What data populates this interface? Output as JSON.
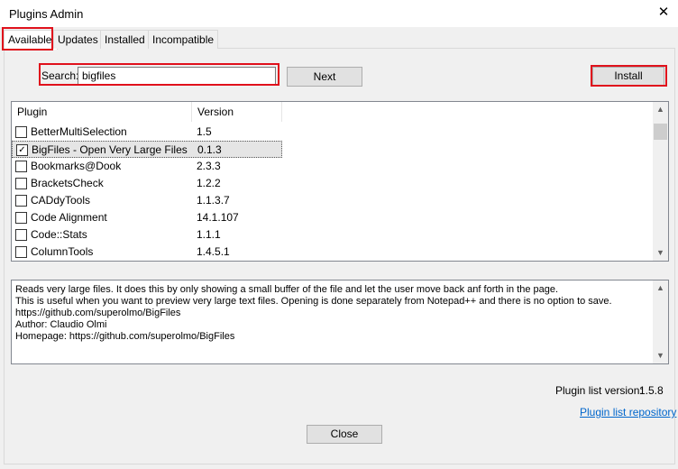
{
  "window": {
    "title": "Plugins Admin"
  },
  "tabs": [
    {
      "label": "Available"
    },
    {
      "label": "Updates"
    },
    {
      "label": "Installed"
    },
    {
      "label": "Incompatible"
    }
  ],
  "search": {
    "label": "Search:",
    "value": "bigfiles"
  },
  "buttons": {
    "next": "Next",
    "install": "Install",
    "close": "Close"
  },
  "list": {
    "headers": {
      "plugin": "Plugin",
      "version": "Version"
    },
    "rows": [
      {
        "name": "BetterMultiSelection",
        "version": "1.5",
        "checked": false
      },
      {
        "name": "BigFiles - Open Very Large Files",
        "version": "0.1.3",
        "checked": true
      },
      {
        "name": "Bookmarks@Dook",
        "version": "2.3.3",
        "checked": false
      },
      {
        "name": "BracketsCheck",
        "version": "1.2.2",
        "checked": false
      },
      {
        "name": "CADdyTools",
        "version": "1.1.3.7",
        "checked": false
      },
      {
        "name": "Code Alignment",
        "version": "14.1.107",
        "checked": false
      },
      {
        "name": "Code::Stats",
        "version": "1.1.1",
        "checked": false
      },
      {
        "name": "ColumnTools",
        "version": "1.4.5.1",
        "checked": false
      }
    ]
  },
  "description": {
    "lines": [
      "Reads very large files. It does this by only showing a small buffer of the file and let the user move back anf forth in the page.",
      "This is useful when you want to preview very large text files. Opening is done separately from Notepad++ and there is no option to save.",
      "https://github.com/superolmo/BigFiles",
      "Author: Claudio Olmi",
      "Homepage: https://github.com/superolmo/BigFiles"
    ]
  },
  "footer": {
    "plugin_list_version_label": "Plugin list version:",
    "plugin_list_version": "1.5.8",
    "repository_link": "Plugin list repository"
  },
  "colors": {
    "highlight": "#e0111c",
    "link": "#0066cc"
  }
}
